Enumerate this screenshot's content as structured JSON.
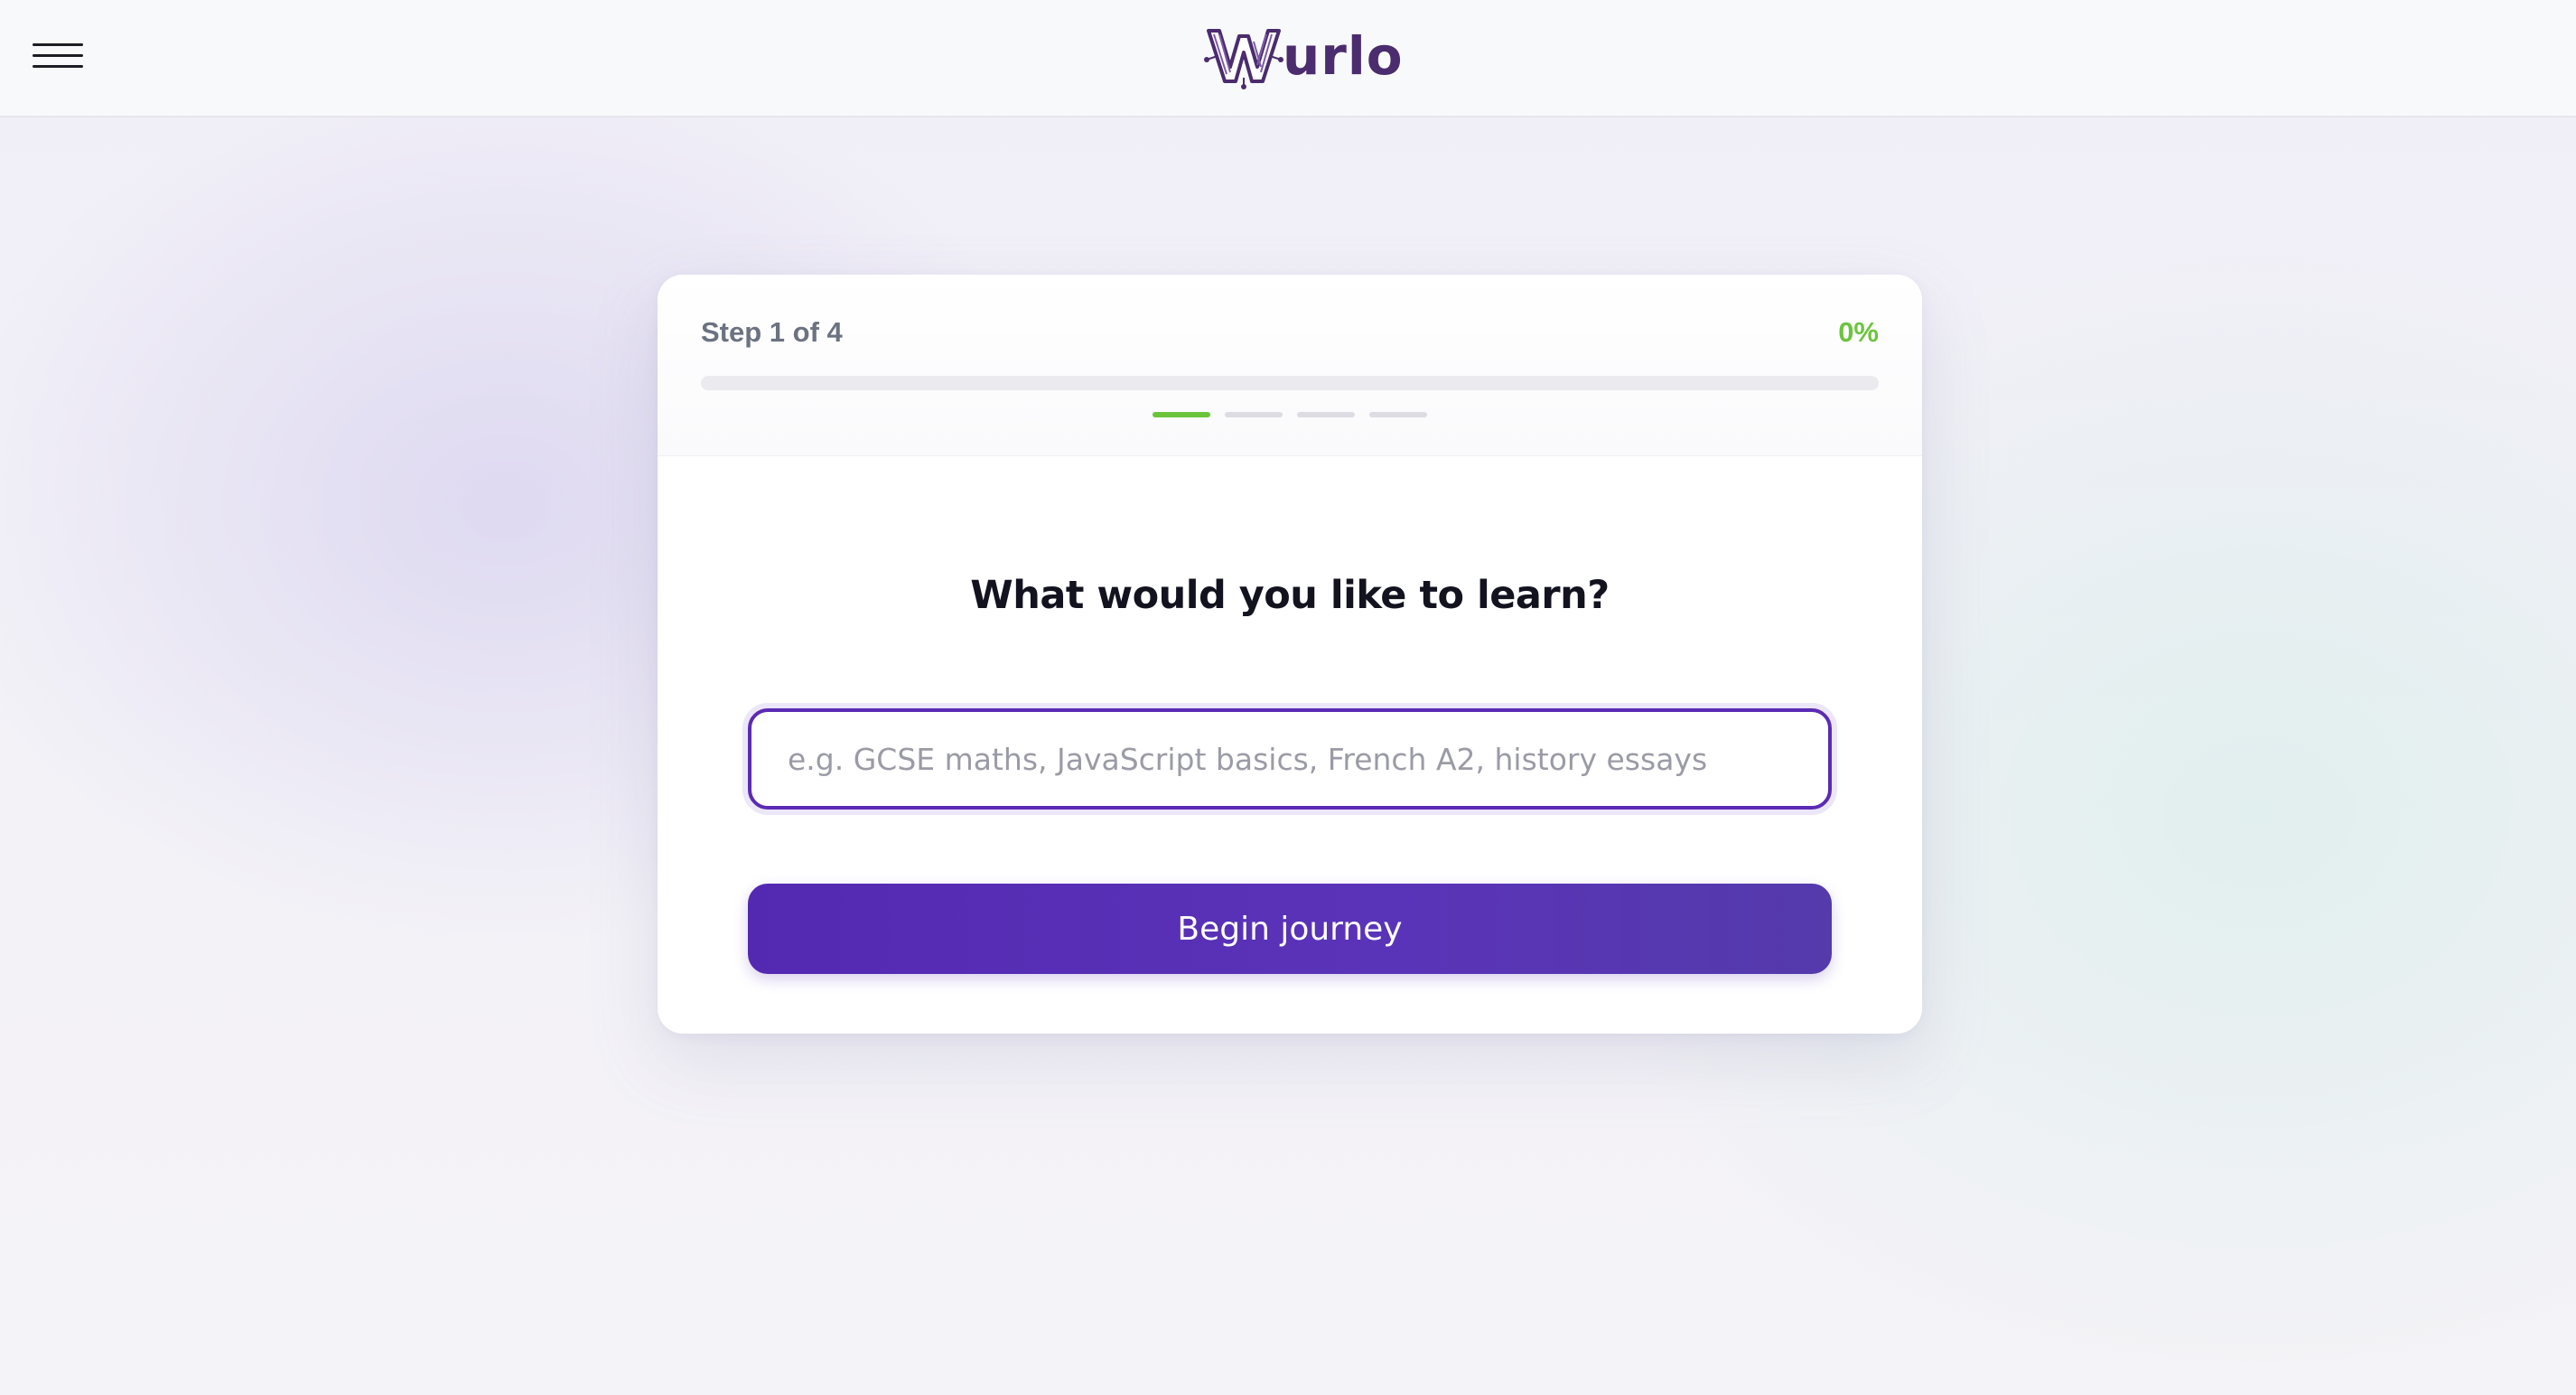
{
  "header": {
    "menu_icon": "hamburger-menu-icon",
    "logo_text": "urlo",
    "logo_mark_letter": "W"
  },
  "wizard": {
    "step_label": "Step 1 of 4",
    "percent_label": "0%",
    "progress": 0,
    "total_steps": 4,
    "current_step": 1,
    "question": "What would you like to learn?",
    "input": {
      "value": "",
      "placeholder": "e.g. GCSE maths, JavaScript basics, French A2, history essays"
    },
    "submit_label": "Begin journey"
  },
  "colors": {
    "accent": "#5429b2",
    "progress_green": "#6cc43c",
    "logo": "#4b2c6e"
  }
}
